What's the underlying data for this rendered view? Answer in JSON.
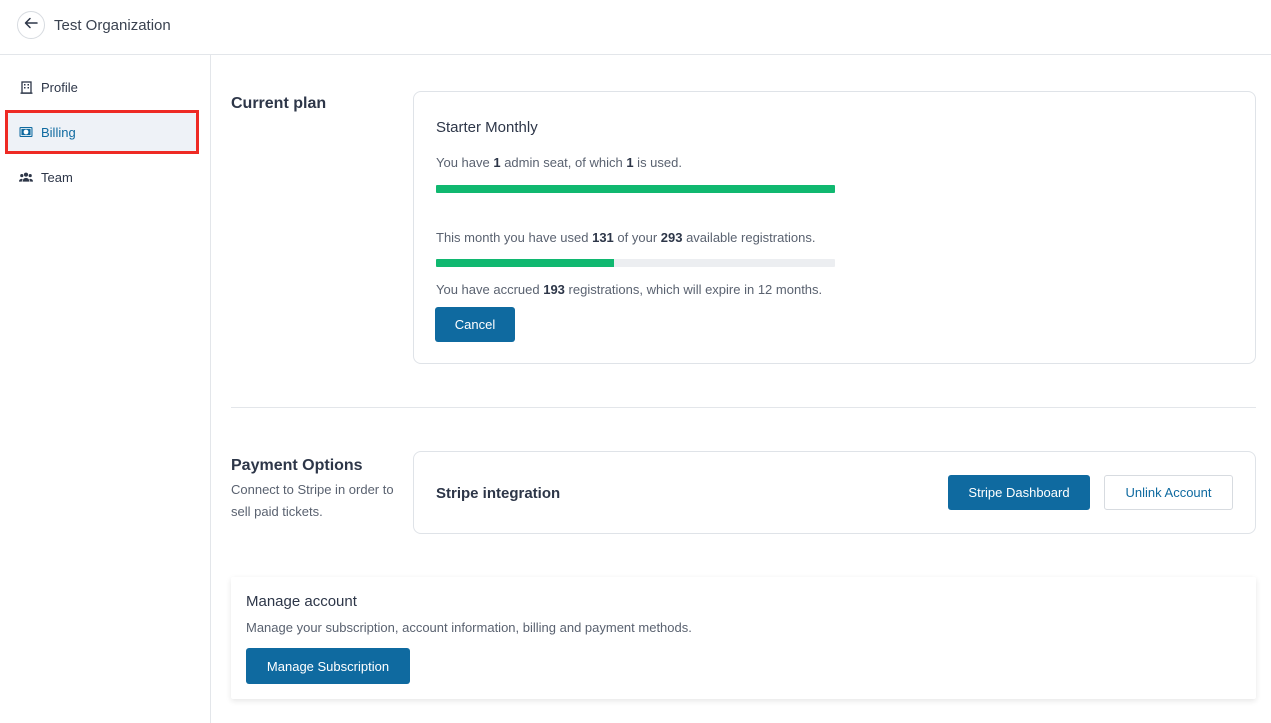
{
  "header": {
    "title": "Test Organization"
  },
  "sidebar": {
    "items": [
      {
        "label": "Profile",
        "icon": "building-icon"
      },
      {
        "label": "Billing",
        "icon": "money-icon"
      },
      {
        "label": "Team",
        "icon": "team-icon"
      }
    ],
    "active": "Billing"
  },
  "current_plan": {
    "section_title": "Current plan",
    "plan_name": "Starter Monthly",
    "seats": {
      "prefix": "You have ",
      "total": "1",
      "middle": " admin seat, of which ",
      "used": "1",
      "suffix": " is used.",
      "progress_fraction": 1.0
    },
    "registrations": {
      "prefix": "This month you have used ",
      "used": "131",
      "middle": " of your ",
      "total": "293",
      "suffix": " available registrations.",
      "progress_fraction": 0.447
    },
    "accrued": {
      "prefix": "You have accrued ",
      "count": "193",
      "suffix": " registrations, which will expire in 12 months."
    },
    "cancel_label": "Cancel"
  },
  "payment_options": {
    "section_title": "Payment Options",
    "description": "Connect to Stripe in order to sell paid tickets.",
    "integration_label": "Stripe integration",
    "dashboard_label": "Stripe Dashboard",
    "unlink_label": "Unlink Account"
  },
  "manage_account": {
    "title": "Manage account",
    "description": "Manage your subscription, account information, billing and payment methods.",
    "button_label": "Manage Subscription"
  },
  "colors": {
    "primary": "#0f6aa0",
    "progress": "#10b870",
    "highlight": "#ee2a24"
  }
}
